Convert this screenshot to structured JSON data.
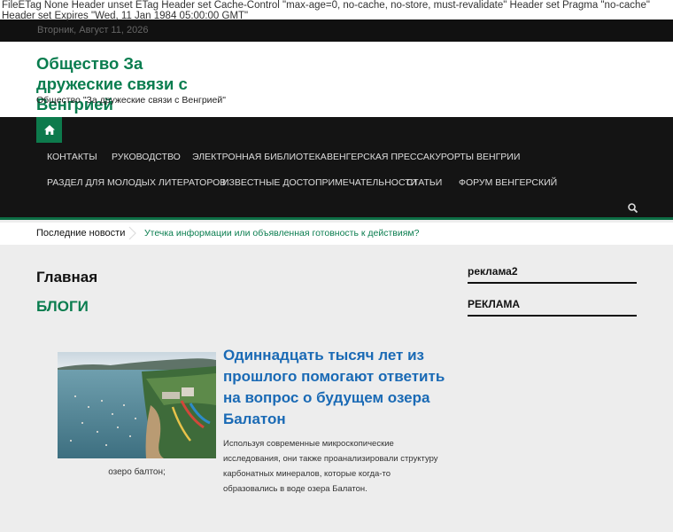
{
  "raw_headers_text": "FileETag None Header unset ETag Header set Cache-Control \"max-age=0, no-cache, no-store, must-revalidate\" Header set Pragma \"no-cache\" Header set Expires \"Wed, 11 Jan 1984 05:00:00 GMT\"",
  "topbar": {
    "date": "Вторник, Август 11, 2026"
  },
  "header": {
    "site_title": "Общество За дружеские связи с Венгрией",
    "site_description": "Общество \"За дружеские связи с Венгрией\""
  },
  "nav": {
    "home_icon": "home-icon",
    "row1": [
      "Контакты",
      "Руководство",
      "Электронная библиотека",
      "Венгерская пресса",
      "Курорты Венгрии"
    ],
    "row2": [
      "Раздел для молодых литераторов",
      "Известные достопримечательности",
      "Статьи",
      "Форум венгерский"
    ],
    "search_icon": "search-icon"
  },
  "ticker": {
    "label": "Последние новости",
    "link": "Утечка информации или объявленная готовность к действиям?"
  },
  "main": {
    "page_title": "Главная",
    "section_heading": "БЛОГИ",
    "article": {
      "title": "Одиннадцать тысяч лет из прошлого помогают ответить на вопрос о будущем озера Балатон",
      "image_caption": "озеро балтон;",
      "excerpt": "Используя современные микроскопические исследования, они также проанализировали структуру карбонатных минералов, которые когда-то образовались в воде озера Балатон."
    }
  },
  "sidebar": {
    "widgets": [
      {
        "title": "реклама2"
      },
      {
        "title": "РЕКЛАМА"
      }
    ]
  },
  "colors": {
    "brand_green": "#0a7d4f",
    "nav_bg": "#141414",
    "link_blue": "#1a6ab5"
  }
}
